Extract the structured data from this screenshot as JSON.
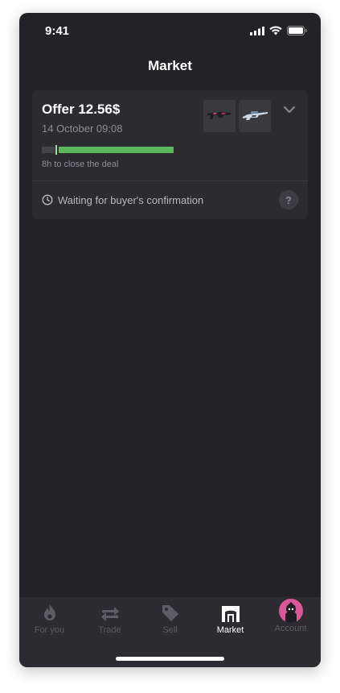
{
  "status_bar": {
    "time": "9:41"
  },
  "header": {
    "title": "Market"
  },
  "offer": {
    "title": "Offer 12.56$",
    "date": "14 October 09:08",
    "progress_fraction": 0.9,
    "progress_caption": "8h to close the deal",
    "status_text": "Waiting for buyer's confirmation",
    "help_label": "?",
    "items": [
      {
        "name": "rifle-skin-thumbnail"
      },
      {
        "name": "sniper-skin-thumbnail"
      }
    ]
  },
  "tabbar": {
    "items": [
      {
        "label": "For you",
        "icon": "flame-icon",
        "active": false
      },
      {
        "label": "Trade",
        "icon": "swap-arrows-icon",
        "active": false
      },
      {
        "label": "Sell",
        "icon": "tag-icon",
        "active": false
      },
      {
        "label": "Market",
        "icon": "storefront-icon",
        "active": true
      },
      {
        "label": "Account",
        "icon": "avatar",
        "active": false
      }
    ]
  },
  "colors": {
    "background": "#232226",
    "card": "#2c2b30",
    "progress_green": "#5cb85c",
    "avatar_pink": "#d9579a"
  }
}
